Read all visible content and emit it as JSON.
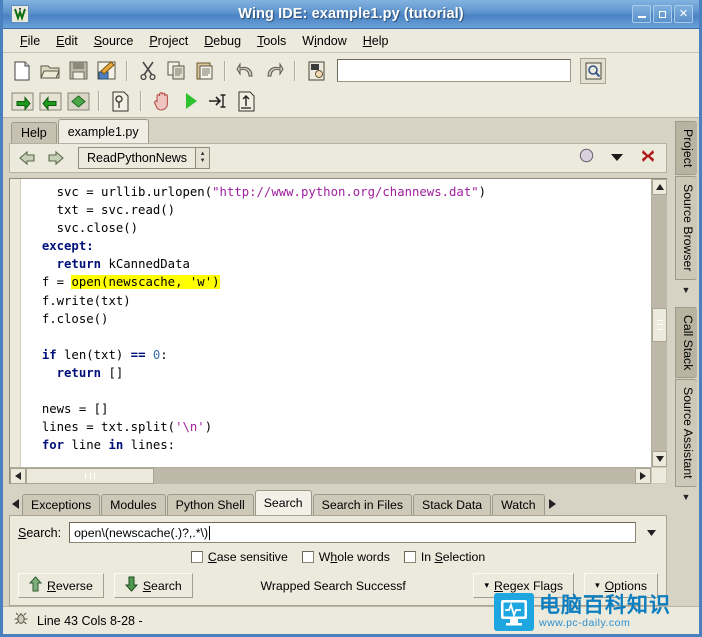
{
  "window": {
    "title": "Wing IDE: example1.py (tutorial)",
    "app_icon": "wing-ide-logo-icon",
    "buttons": {
      "minimize": "minimize-icon",
      "maximize": "maximize-icon",
      "close": "close-icon"
    }
  },
  "menubar": {
    "items": [
      "File",
      "Edit",
      "Source",
      "Project",
      "Debug",
      "Tools",
      "Window",
      "Help"
    ]
  },
  "toolbar": {
    "row1": [
      {
        "name": "new-file-icon",
        "title": "New"
      },
      {
        "name": "open-folder-icon",
        "title": "Open"
      },
      {
        "name": "save-icon",
        "title": "Save"
      },
      {
        "name": "save-as-icon",
        "title": "Save As"
      },
      {
        "name": "cut-icon",
        "title": "Cut"
      },
      {
        "name": "copy-icon",
        "title": "Copy"
      },
      {
        "name": "paste-icon",
        "title": "Paste"
      },
      {
        "name": "undo-icon",
        "title": "Undo"
      },
      {
        "name": "redo-icon",
        "title": "Redo"
      },
      {
        "name": "find-in-file-icon",
        "title": "Find"
      }
    ],
    "quick_find_value": "",
    "quick_find_placeholder": "",
    "quick_find_button_icon": "search-magnifier-icon",
    "row2": [
      {
        "name": "step-forward-icon",
        "title": "Step Forward"
      },
      {
        "name": "step-back-icon",
        "title": "Step Back"
      },
      {
        "name": "step-over-icon",
        "title": "Step Over"
      },
      {
        "name": "debug-probe-icon",
        "title": "Debug Probe"
      },
      {
        "name": "stop-hand-icon",
        "title": "Stop"
      },
      {
        "name": "run-icon",
        "title": "Run"
      },
      {
        "name": "step-into-icon",
        "title": "Step Into"
      },
      {
        "name": "step-out-icon",
        "title": "Step Out"
      }
    ]
  },
  "editor": {
    "tabs": [
      {
        "label": "Help",
        "active": false
      },
      {
        "label": "example1.py",
        "active": true
      }
    ],
    "nav": {
      "back_icon": "back-arrow-icon",
      "forward_icon": "forward-arrow-icon",
      "symbol_selector": "ReadPythonNews",
      "moon_icon": "break-toggle-icon",
      "menu_icon": "chevron-down-icon",
      "close_icon": "close-editor-icon"
    },
    "code_lines": [
      {
        "indent": 4,
        "parts": [
          {
            "t": "svc = urllib.urlopen(",
            "c": "plain"
          },
          {
            "t": "\"http://www.python.org/channews.dat\"",
            "c": "str"
          },
          {
            "t": ")",
            "c": "plain"
          }
        ]
      },
      {
        "indent": 4,
        "parts": [
          {
            "t": "txt = svc.read()",
            "c": "plain"
          }
        ]
      },
      {
        "indent": 4,
        "parts": [
          {
            "t": "svc.close()",
            "c": "plain"
          }
        ]
      },
      {
        "indent": 2,
        "parts": [
          {
            "t": "except:",
            "c": "kw"
          }
        ]
      },
      {
        "indent": 4,
        "parts": [
          {
            "t": "return",
            "c": "kw"
          },
          {
            "t": " kCannedData",
            "c": "plain"
          }
        ]
      },
      {
        "indent": 2,
        "parts": [
          {
            "t": "f = ",
            "c": "plain"
          },
          {
            "t": "open(newscache, 'w')",
            "c": "hl"
          }
        ]
      },
      {
        "indent": 2,
        "parts": [
          {
            "t": "f.write(txt)",
            "c": "plain"
          }
        ]
      },
      {
        "indent": 2,
        "parts": [
          {
            "t": "f.close()",
            "c": "plain"
          }
        ]
      },
      {
        "indent": 0,
        "parts": [
          {
            "t": "",
            "c": "plain"
          }
        ]
      },
      {
        "indent": 2,
        "parts": [
          {
            "t": "if",
            "c": "kw"
          },
          {
            "t": " len(txt) ",
            "c": "plain"
          },
          {
            "t": "==",
            "c": "kw"
          },
          {
            "t": " ",
            "c": "plain"
          },
          {
            "t": "0",
            "c": "num"
          },
          {
            "t": ":",
            "c": "plain"
          }
        ]
      },
      {
        "indent": 4,
        "parts": [
          {
            "t": "return",
            "c": "kw"
          },
          {
            "t": " []",
            "c": "plain"
          }
        ]
      },
      {
        "indent": 0,
        "parts": [
          {
            "t": "",
            "c": "plain"
          }
        ]
      },
      {
        "indent": 2,
        "parts": [
          {
            "t": "news = []",
            "c": "plain"
          }
        ]
      },
      {
        "indent": 2,
        "parts": [
          {
            "t": "lines = txt.split(",
            "c": "plain"
          },
          {
            "t": "'\\n'",
            "c": "str"
          },
          {
            "t": ")",
            "c": "plain"
          }
        ]
      },
      {
        "indent": 2,
        "parts": [
          {
            "t": "for",
            "c": "kw"
          },
          {
            "t": " line ",
            "c": "plain"
          },
          {
            "t": "in",
            "c": "kw"
          },
          {
            "t": " lines:",
            "c": "plain"
          }
        ]
      }
    ],
    "vscroll": {
      "up_icon": "scroll-up-icon",
      "down_icon": "scroll-down-icon"
    },
    "hscroll": {
      "left_icon": "scroll-left-icon",
      "right_icon": "scroll-right-icon"
    }
  },
  "bottom_panel": {
    "tab_scroll_left_icon": "tab-scroll-left-icon",
    "tab_scroll_right_icon": "tab-scroll-right-icon",
    "tabs": [
      {
        "label": "Exceptions",
        "active": false
      },
      {
        "label": "Modules",
        "active": false
      },
      {
        "label": "Python Shell",
        "active": false
      },
      {
        "label": "Search",
        "active": true
      },
      {
        "label": "Search in Files",
        "active": false
      },
      {
        "label": "Stack Data",
        "active": false
      },
      {
        "label": "Watch",
        "active": false
      }
    ],
    "search": {
      "label": "Search:",
      "value": "open\\(newscache(.)?,.*\\)",
      "placeholder": "",
      "dropdown_icon": "chevron-down-icon",
      "checkboxes": [
        {
          "label": "Case sensitive",
          "checked": false
        },
        {
          "label": "Whole words",
          "checked": false
        },
        {
          "label": "In Selection",
          "checked": false
        }
      ],
      "reverse_button": "Reverse",
      "reverse_icon": "arrow-up-icon",
      "search_button": "Search",
      "search_icon": "arrow-down-icon",
      "status": "Wrapped Search Successf",
      "regex_flags_button": "Regex Flags",
      "options_button": "Options",
      "dropdown_marker": "▾"
    }
  },
  "right_rail": {
    "items": [
      {
        "label": "Project",
        "active": true
      },
      {
        "label": "Source Browser",
        "active": false
      }
    ],
    "collapse_icon_top": "▼",
    "items2": [
      {
        "label": "Call Stack",
        "active": true
      },
      {
        "label": "Source Assistant",
        "active": false
      }
    ],
    "collapse_icon_bottom": "▼"
  },
  "statusbar": {
    "icon": "bug-icon",
    "text": "Line 43 Cols 8-28 -"
  },
  "watermark": {
    "icon": "monitor-pulse-icon",
    "title": "电脑百科知识",
    "url": "www.pc-daily.com"
  },
  "colors": {
    "title_blue": "#5d93cd",
    "chrome": "#ece9dd",
    "highlight_yellow": "#ffff00",
    "keyword_blue": "#00107a",
    "string_purple": "#a020a0"
  }
}
